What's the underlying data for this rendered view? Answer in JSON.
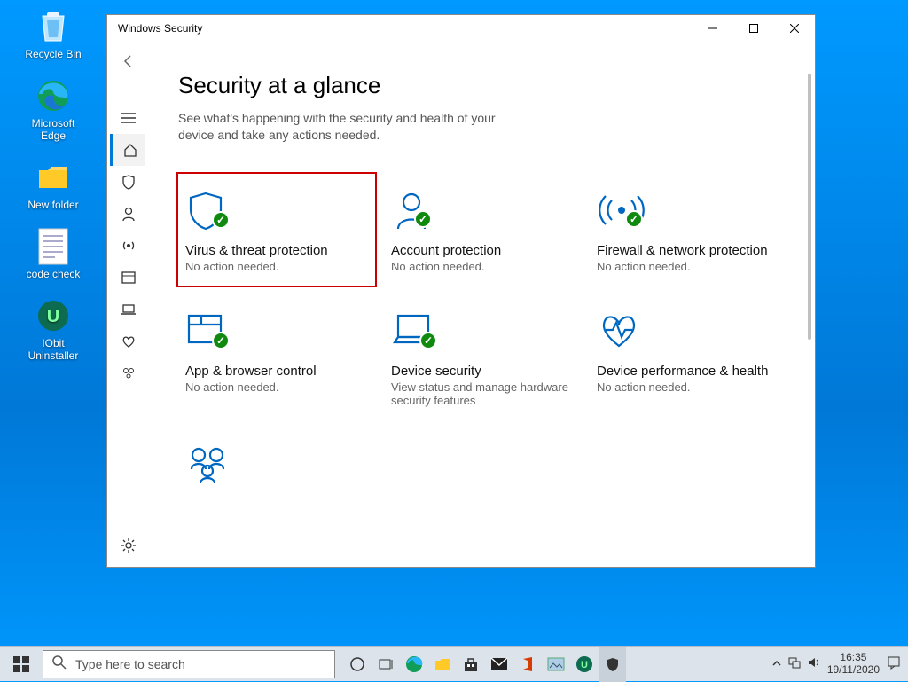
{
  "desktop": {
    "icons": [
      {
        "name": "recycle-bin",
        "label": "Recycle Bin"
      },
      {
        "name": "ms-edge",
        "label": "Microsoft Edge"
      },
      {
        "name": "new-folder",
        "label": "New folder"
      },
      {
        "name": "code-check",
        "label": "code check"
      },
      {
        "name": "iobit-uninstaller",
        "label": "IObit Uninstaller"
      }
    ]
  },
  "window": {
    "title": "Windows Security",
    "page_title": "Security at a glance",
    "page_subtitle": "See what's happening with the security and health of your device and take any actions needed.",
    "sidebar": [
      {
        "name": "back",
        "icon": "back"
      },
      {
        "name": "menu",
        "icon": "menu"
      },
      {
        "name": "home",
        "icon": "home",
        "selected": true
      },
      {
        "name": "virus",
        "icon": "shield"
      },
      {
        "name": "account",
        "icon": "person"
      },
      {
        "name": "firewall",
        "icon": "antenna"
      },
      {
        "name": "app-browser",
        "icon": "window"
      },
      {
        "name": "device-security",
        "icon": "laptop"
      },
      {
        "name": "device-performance",
        "icon": "heart"
      },
      {
        "name": "family",
        "icon": "family"
      }
    ],
    "settings_icon": "settings",
    "tiles": [
      {
        "name": "virus-threat",
        "title": "Virus & threat protection",
        "status": "No action needed.",
        "icon": "shield",
        "check": true,
        "highlight": true
      },
      {
        "name": "account-protection",
        "title": "Account protection",
        "status": "No action needed.",
        "icon": "person",
        "check": true
      },
      {
        "name": "firewall-network",
        "title": "Firewall & network protection",
        "status": "No action needed.",
        "icon": "antenna",
        "check": true
      },
      {
        "name": "app-browser-control",
        "title": "App & browser control",
        "status": "No action needed.",
        "icon": "window",
        "check": true
      },
      {
        "name": "device-security",
        "title": "Device security",
        "status": "View status and manage hardware security features",
        "icon": "laptop",
        "check": true
      },
      {
        "name": "device-performance",
        "title": "Device performance & health",
        "status": "No action needed.",
        "icon": "heart",
        "check": false
      },
      {
        "name": "family-options",
        "title": "",
        "status": "",
        "icon": "family",
        "check": false
      }
    ]
  },
  "taskbar": {
    "search_placeholder": "Type here to search",
    "clock_time": "16:35",
    "clock_date": "19/11/2020"
  }
}
